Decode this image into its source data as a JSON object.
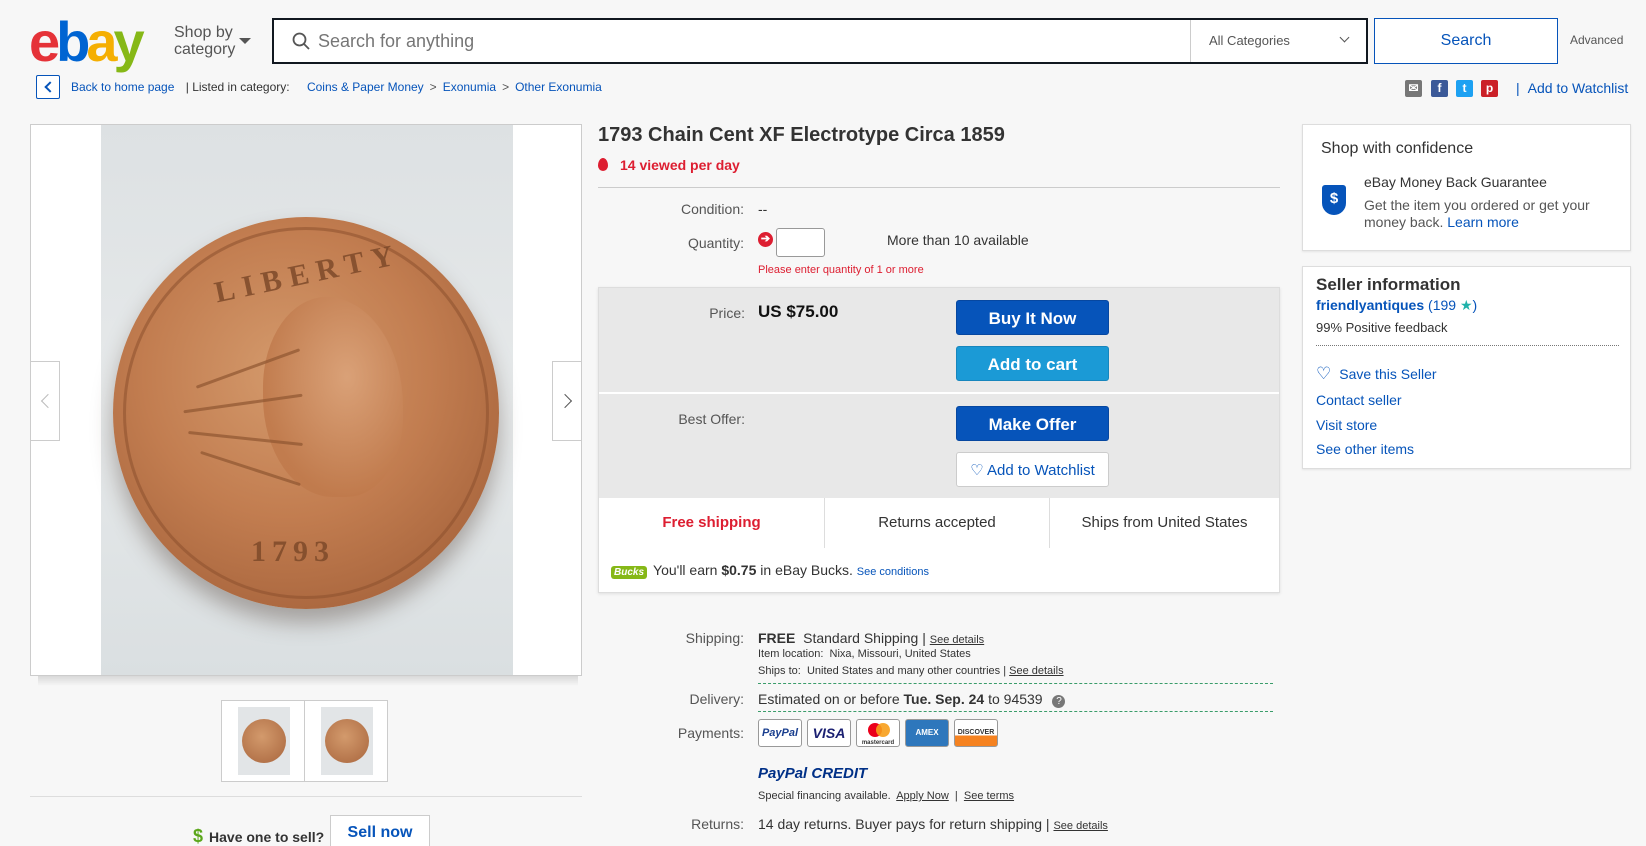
{
  "header": {
    "logo_letters": [
      "e",
      "b",
      "a",
      "y"
    ],
    "shop_by_line1": "Shop by",
    "shop_by_line2": "category",
    "search_placeholder": "Search for anything",
    "category_select": "All Categories",
    "search_button": "Search",
    "advanced_link": "Advanced"
  },
  "breadcrumb": {
    "back": "Back to home page",
    "listed_in": "| Listed in category:",
    "items": [
      "Coins & Paper Money",
      "Exonumia",
      "Other Exonumia"
    ],
    "separator": ">"
  },
  "social": {
    "icons": [
      "email-icon",
      "facebook-icon",
      "twitter-icon",
      "pinterest-icon"
    ],
    "add_to_watchlist": "Add to Watchlist"
  },
  "gallery": {
    "coin_legend": "LIBERTY",
    "coin_date": "1793",
    "thumbnails": 2
  },
  "sell": {
    "prompt": "Have one to sell?",
    "button": "Sell now"
  },
  "listing": {
    "title": "1793 Chain Cent XF Electrotype Circa 1859",
    "views": "14 viewed per day",
    "condition_label": "Condition:",
    "condition_value": "--",
    "quantity_label": "Quantity:",
    "quantity_value": "",
    "available": "More than 10 available",
    "quantity_error": "Please enter quantity of 1 or more",
    "price_label": "Price:",
    "price": "US $75.00",
    "buy_now": "Buy It Now",
    "add_to_cart": "Add to cart",
    "best_offer_label": "Best Offer:",
    "make_offer": "Make Offer",
    "add_to_watchlist": "Add to Watchlist",
    "features": [
      "Free shipping",
      "Returns accepted",
      "Ships from United States"
    ],
    "bucks_logo": "Bucks",
    "bucks_pre": "You'll earn",
    "bucks_amount": "$0.75",
    "bucks_post": "in eBay Bucks.",
    "bucks_link": "See conditions"
  },
  "shipping": {
    "label": "Shipping:",
    "free": "FREE",
    "method": "Standard Shipping |",
    "details_link": "See details",
    "location_label": "Item location:",
    "location": "Nixa, Missouri, United States",
    "ships_to_label": "Ships to:",
    "ships_to": "United States and many other countries |",
    "ships_to_link": "See details"
  },
  "delivery": {
    "label": "Delivery:",
    "pre": "Estimated on or before",
    "date": "Tue. Sep. 24",
    "to": "to 94539",
    "help": "?"
  },
  "payments": {
    "label": "Payments:",
    "methods": [
      "PayPal",
      "VISA",
      "mastercard",
      "AMEX",
      "DISCOVER"
    ],
    "paypal_credit": "PayPal CREDIT",
    "financing": "Special financing available.",
    "apply_now": "Apply Now",
    "separator": "|",
    "see_terms": "See terms"
  },
  "returns": {
    "label": "Returns:",
    "text": "14 day returns. Buyer pays for return shipping |",
    "link": "See details"
  },
  "confidence": {
    "title": "Shop with confidence",
    "guarantee": "eBay Money Back Guarantee",
    "desc_line1": "Get the item you ordered or get your",
    "desc_line2": "money back.",
    "learn_more": "Learn more",
    "shield_symbol": "$"
  },
  "seller": {
    "title": "Seller information",
    "name": "friendlyantiques",
    "feedback_count_open": "(",
    "feedback_count": "199",
    "feedback_count_close": ")",
    "positive": "99% Positive feedback",
    "save": "Save this Seller",
    "contact": "Contact seller",
    "visit": "Visit store",
    "other": "See other items"
  },
  "colors": {
    "link": "#0654ba",
    "alert": "#dd1e31",
    "buy_button": "#0654ba",
    "cart_button": "#1b9ad6"
  }
}
